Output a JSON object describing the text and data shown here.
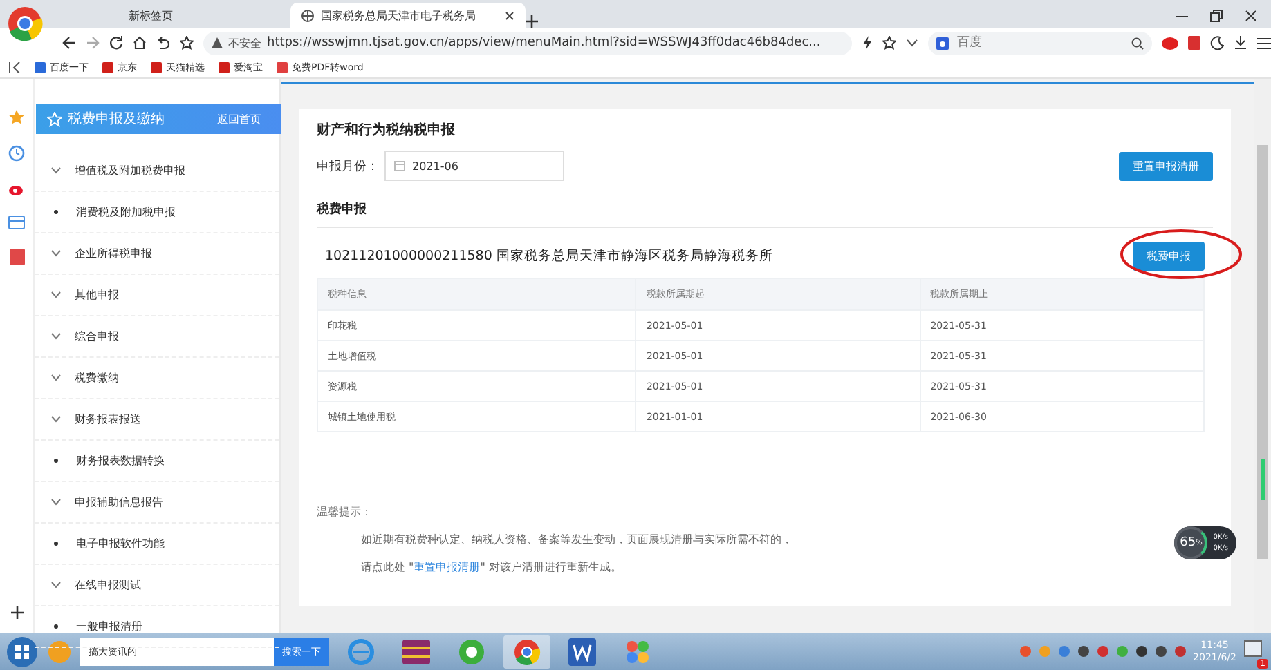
{
  "browser": {
    "tabs": [
      {
        "label": "新标签页",
        "selected": false
      },
      {
        "label": "国家税务总局天津市电子税务局",
        "selected": true
      }
    ],
    "security_label": "不安全",
    "url": "https://wsswjmn.tjsat.gov.cn/apps/view/menuMain.html?sid=WSSWJ43ff0dac46b84dec...",
    "search": {
      "placeholder": "百度"
    },
    "bookmarks": [
      "百度一下",
      "京东",
      "天猫精选",
      "爱淘宝",
      "免费PDF转word"
    ]
  },
  "sidebar": {
    "title": "税费申报及缴纳",
    "home_link": "返回首页",
    "items": [
      {
        "label": "增值税及附加税费申报",
        "kind": "group"
      },
      {
        "label": "消费税及附加税申报",
        "kind": "leaf"
      },
      {
        "label": "企业所得税申报",
        "kind": "group"
      },
      {
        "label": "其他申报",
        "kind": "group"
      },
      {
        "label": "综合申报",
        "kind": "group"
      },
      {
        "label": "税费缴纳",
        "kind": "group"
      },
      {
        "label": "财务报表报送",
        "kind": "group"
      },
      {
        "label": "财务报表数据转换",
        "kind": "leaf"
      },
      {
        "label": "申报辅助信息报告",
        "kind": "group"
      },
      {
        "label": "电子申报软件功能",
        "kind": "leaf"
      },
      {
        "label": "在线申报测试",
        "kind": "group"
      },
      {
        "label": "一般申报清册",
        "kind": "leaf"
      }
    ]
  },
  "main": {
    "title": "财产和行为税纳税申报",
    "month_label": "申报月份：",
    "month_value": "2021-06",
    "reset_button": "重置申报清册",
    "section_title": "税费申报",
    "office": "10211201000000211580 国家税务总局天津市静海区税务局静海税务所",
    "declare_button": "税费申报",
    "table": {
      "columns": [
        "税种信息",
        "税款所属期起",
        "税款所属期止"
      ],
      "rows": [
        [
          "印花税",
          "2021-05-01",
          "2021-05-31"
        ],
        [
          "土地增值税",
          "2021-05-01",
          "2021-05-31"
        ],
        [
          "资源税",
          "2021-05-01",
          "2021-05-31"
        ],
        [
          "城镇土地使用税",
          "2021-01-01",
          "2021-06-30"
        ]
      ]
    },
    "tip_title": "温馨提示：",
    "tip_line": "如近期有税费种认定、纳税人资格、备案等发生变动，页面展现清册与实际所需不符的，",
    "tip_prefix": "请点此处 \"",
    "tip_link": "重置申报清册",
    "tip_suffix": "\" 对该户清册进行重新生成。"
  },
  "widget": {
    "percent": "65",
    "unit": "%",
    "up": "0K/s",
    "down": "0K/s"
  },
  "taskbar": {
    "search_value": "搞大资讯的",
    "search_button": "搜索一下",
    "time": "11:45",
    "date": "2021/6/2",
    "notification_count": "1"
  }
}
